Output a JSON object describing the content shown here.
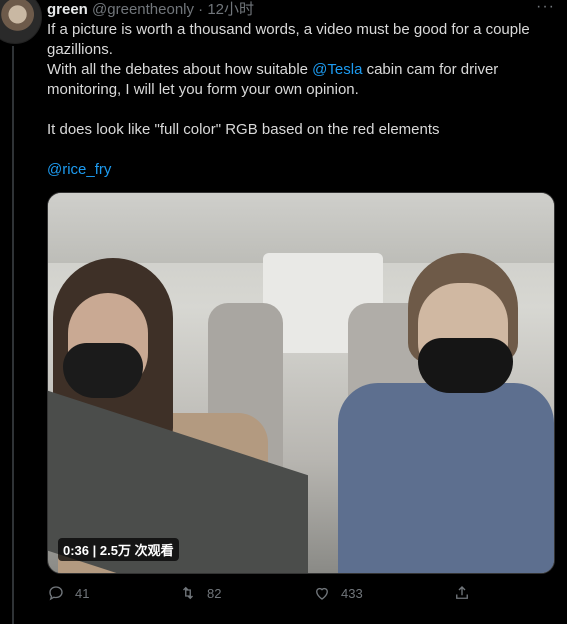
{
  "tweet": {
    "author_name": "green",
    "author_handle": "@greentheonly",
    "separator": "·",
    "time": "12小时",
    "more": "···",
    "text": {
      "line1": "If a picture is worth a thousand words, a video must be good for a couple gazillions.",
      "line2_pre": "With all the debates about how suitable ",
      "line2_mention": "@Tesla",
      "line2_post": " cabin cam for driver monitoring, I will let you form your own opinion.",
      "line3": "It does look like \"full color\" RGB based on the red elements",
      "mention_rice": "@rice_fry"
    },
    "media": {
      "badge": "0:36 | 2.5万 次观看"
    },
    "actions": {
      "reply_count": "41",
      "retweet_count": "82",
      "like_count": "433"
    }
  },
  "colors": {
    "background": "#000000",
    "text": "#d9d9d9",
    "muted": "#71767b",
    "link": "#1d9bf0"
  }
}
